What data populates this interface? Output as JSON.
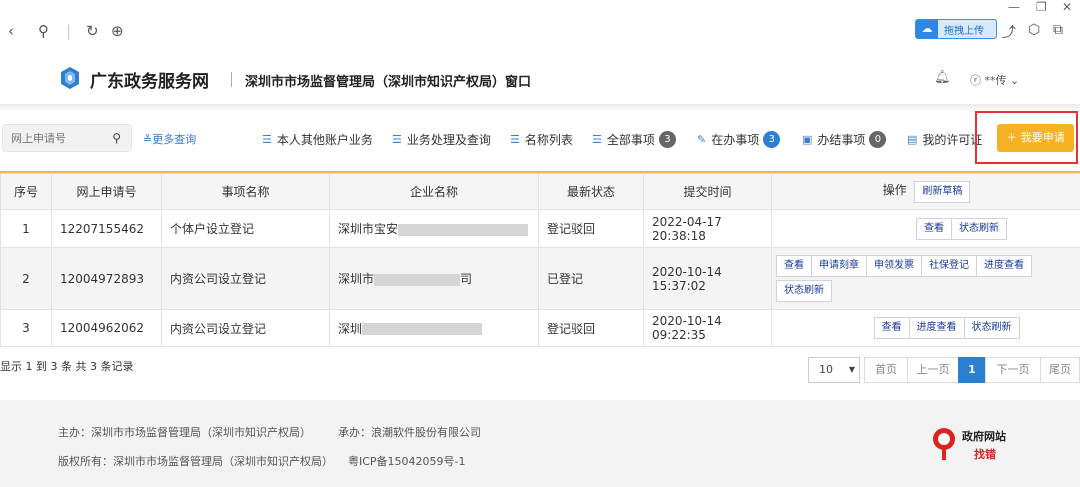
{
  "browser": {
    "upload_label": "拖拽上传"
  },
  "header": {
    "site_name": "广东政务服务网",
    "dept_name": "深圳市市场监督管理局（深圳市知识产权局）窗口",
    "user": "**传"
  },
  "toolbar": {
    "search_placeholder": "网上申请号",
    "more_query": "更多查询",
    "items": [
      {
        "label": "本人其他账户业务"
      },
      {
        "label": "业务处理及查询"
      },
      {
        "label": "名称列表"
      },
      {
        "label": "全部事项",
        "badge": "3"
      },
      {
        "label": "在办事项",
        "badge": "3"
      },
      {
        "label": "办结事项",
        "badge": "0"
      },
      {
        "label": "我的许可证"
      }
    ],
    "apply_label": "我要申请"
  },
  "table": {
    "headers": [
      "序号",
      "网上申请号",
      "事项名称",
      "企业名称",
      "最新状态",
      "提交时间",
      "操作"
    ],
    "refresh_draft": "刷新草稿",
    "rows": [
      {
        "no": "1",
        "app_no": "12207155462",
        "item": "个体户设立登记",
        "company_prefix": "深圳市宝安",
        "company_suffix": "",
        "status": "登记驳回",
        "time": "2022-04-17 20:38:18",
        "ops": [
          "查看",
          "状态刷新"
        ]
      },
      {
        "no": "2",
        "app_no": "12004972893",
        "item": "内资公司设立登记",
        "company_prefix": "深圳市",
        "company_suffix": "司",
        "status": "已登记",
        "time": "2020-10-14 15:37:02",
        "ops": [
          "查看",
          "申请刻章",
          "申领发票",
          "社保登记",
          "进度查看",
          "状态刷新"
        ]
      },
      {
        "no": "3",
        "app_no": "12004962062",
        "item": "内资公司设立登记",
        "company_prefix": "深圳",
        "company_suffix": "",
        "status": "登记驳回",
        "time": "2020-10-14 09:22:35",
        "ops": [
          "查看",
          "进度查看",
          "状态刷新"
        ]
      }
    ]
  },
  "pagination": {
    "records": "显示 1 到 3 条 共 3 条记录",
    "page_size": "10",
    "first": "首页",
    "prev": "上一页",
    "current": "1",
    "next": "下一页",
    "last": "尾页"
  },
  "footer": {
    "host": "主办：深圳市市场监督管理局（深圳市知识产权局）",
    "undertake": "承办：浪潮软件股份有限公司",
    "copyright": "版权所有：深圳市市场监督管理局（深圳市知识产权局）",
    "icp": "粤ICP备15042059号-1",
    "badge_title": "政府网站",
    "badge_sub": "找错"
  },
  "colors": {
    "accent": "#2d7fd0",
    "apply": "#f5b324",
    "highlight": "#e53131"
  }
}
